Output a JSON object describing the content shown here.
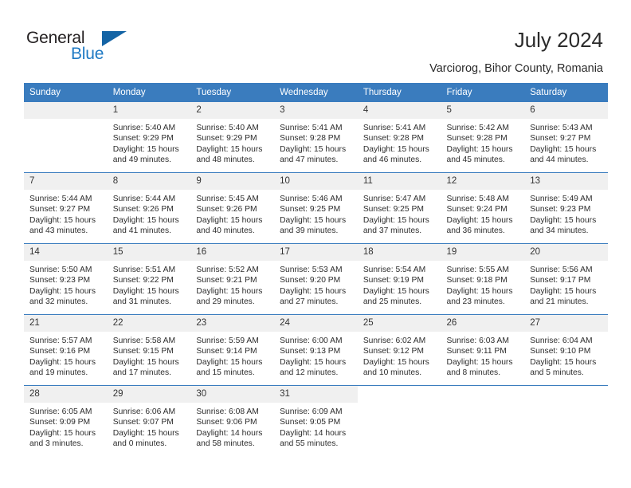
{
  "brand": {
    "line1": "General",
    "line2": "Blue",
    "logo_icon": "triangle-logo-icon",
    "colors": {
      "blue": "#1f7ac4",
      "dark_blue": "#1464a5",
      "text": "#231f20"
    }
  },
  "header": {
    "title": "July 2024",
    "subtitle": "Varciorog, Bihor County, Romania"
  },
  "calendar": {
    "accent_color": "#3a7cbe",
    "daynum_bg": "#f0f0f0",
    "weekday_headers": [
      "Sunday",
      "Monday",
      "Tuesday",
      "Wednesday",
      "Thursday",
      "Friday",
      "Saturday"
    ],
    "weeks": [
      [
        {
          "day": "",
          "lines": []
        },
        {
          "day": "1",
          "lines": [
            "Sunrise: 5:40 AM",
            "Sunset: 9:29 PM",
            "Daylight: 15 hours",
            "and 49 minutes."
          ]
        },
        {
          "day": "2",
          "lines": [
            "Sunrise: 5:40 AM",
            "Sunset: 9:29 PM",
            "Daylight: 15 hours",
            "and 48 minutes."
          ]
        },
        {
          "day": "3",
          "lines": [
            "Sunrise: 5:41 AM",
            "Sunset: 9:28 PM",
            "Daylight: 15 hours",
            "and 47 minutes."
          ]
        },
        {
          "day": "4",
          "lines": [
            "Sunrise: 5:41 AM",
            "Sunset: 9:28 PM",
            "Daylight: 15 hours",
            "and 46 minutes."
          ]
        },
        {
          "day": "5",
          "lines": [
            "Sunrise: 5:42 AM",
            "Sunset: 9:28 PM",
            "Daylight: 15 hours",
            "and 45 minutes."
          ]
        },
        {
          "day": "6",
          "lines": [
            "Sunrise: 5:43 AM",
            "Sunset: 9:27 PM",
            "Daylight: 15 hours",
            "and 44 minutes."
          ]
        }
      ],
      [
        {
          "day": "7",
          "lines": [
            "Sunrise: 5:44 AM",
            "Sunset: 9:27 PM",
            "Daylight: 15 hours",
            "and 43 minutes."
          ]
        },
        {
          "day": "8",
          "lines": [
            "Sunrise: 5:44 AM",
            "Sunset: 9:26 PM",
            "Daylight: 15 hours",
            "and 41 minutes."
          ]
        },
        {
          "day": "9",
          "lines": [
            "Sunrise: 5:45 AM",
            "Sunset: 9:26 PM",
            "Daylight: 15 hours",
            "and 40 minutes."
          ]
        },
        {
          "day": "10",
          "lines": [
            "Sunrise: 5:46 AM",
            "Sunset: 9:25 PM",
            "Daylight: 15 hours",
            "and 39 minutes."
          ]
        },
        {
          "day": "11",
          "lines": [
            "Sunrise: 5:47 AM",
            "Sunset: 9:25 PM",
            "Daylight: 15 hours",
            "and 37 minutes."
          ]
        },
        {
          "day": "12",
          "lines": [
            "Sunrise: 5:48 AM",
            "Sunset: 9:24 PM",
            "Daylight: 15 hours",
            "and 36 minutes."
          ]
        },
        {
          "day": "13",
          "lines": [
            "Sunrise: 5:49 AM",
            "Sunset: 9:23 PM",
            "Daylight: 15 hours",
            "and 34 minutes."
          ]
        }
      ],
      [
        {
          "day": "14",
          "lines": [
            "Sunrise: 5:50 AM",
            "Sunset: 9:23 PM",
            "Daylight: 15 hours",
            "and 32 minutes."
          ]
        },
        {
          "day": "15",
          "lines": [
            "Sunrise: 5:51 AM",
            "Sunset: 9:22 PM",
            "Daylight: 15 hours",
            "and 31 minutes."
          ]
        },
        {
          "day": "16",
          "lines": [
            "Sunrise: 5:52 AM",
            "Sunset: 9:21 PM",
            "Daylight: 15 hours",
            "and 29 minutes."
          ]
        },
        {
          "day": "17",
          "lines": [
            "Sunrise: 5:53 AM",
            "Sunset: 9:20 PM",
            "Daylight: 15 hours",
            "and 27 minutes."
          ]
        },
        {
          "day": "18",
          "lines": [
            "Sunrise: 5:54 AM",
            "Sunset: 9:19 PM",
            "Daylight: 15 hours",
            "and 25 minutes."
          ]
        },
        {
          "day": "19",
          "lines": [
            "Sunrise: 5:55 AM",
            "Sunset: 9:18 PM",
            "Daylight: 15 hours",
            "and 23 minutes."
          ]
        },
        {
          "day": "20",
          "lines": [
            "Sunrise: 5:56 AM",
            "Sunset: 9:17 PM",
            "Daylight: 15 hours",
            "and 21 minutes."
          ]
        }
      ],
      [
        {
          "day": "21",
          "lines": [
            "Sunrise: 5:57 AM",
            "Sunset: 9:16 PM",
            "Daylight: 15 hours",
            "and 19 minutes."
          ]
        },
        {
          "day": "22",
          "lines": [
            "Sunrise: 5:58 AM",
            "Sunset: 9:15 PM",
            "Daylight: 15 hours",
            "and 17 minutes."
          ]
        },
        {
          "day": "23",
          "lines": [
            "Sunrise: 5:59 AM",
            "Sunset: 9:14 PM",
            "Daylight: 15 hours",
            "and 15 minutes."
          ]
        },
        {
          "day": "24",
          "lines": [
            "Sunrise: 6:00 AM",
            "Sunset: 9:13 PM",
            "Daylight: 15 hours",
            "and 12 minutes."
          ]
        },
        {
          "day": "25",
          "lines": [
            "Sunrise: 6:02 AM",
            "Sunset: 9:12 PM",
            "Daylight: 15 hours",
            "and 10 minutes."
          ]
        },
        {
          "day": "26",
          "lines": [
            "Sunrise: 6:03 AM",
            "Sunset: 9:11 PM",
            "Daylight: 15 hours",
            "and 8 minutes."
          ]
        },
        {
          "day": "27",
          "lines": [
            "Sunrise: 6:04 AM",
            "Sunset: 9:10 PM",
            "Daylight: 15 hours",
            "and 5 minutes."
          ]
        }
      ],
      [
        {
          "day": "28",
          "lines": [
            "Sunrise: 6:05 AM",
            "Sunset: 9:09 PM",
            "Daylight: 15 hours",
            "and 3 minutes."
          ]
        },
        {
          "day": "29",
          "lines": [
            "Sunrise: 6:06 AM",
            "Sunset: 9:07 PM",
            "Daylight: 15 hours",
            "and 0 minutes."
          ]
        },
        {
          "day": "30",
          "lines": [
            "Sunrise: 6:08 AM",
            "Sunset: 9:06 PM",
            "Daylight: 14 hours",
            "and 58 minutes."
          ]
        },
        {
          "day": "31",
          "lines": [
            "Sunrise: 6:09 AM",
            "Sunset: 9:05 PM",
            "Daylight: 14 hours",
            "and 55 minutes."
          ]
        },
        {
          "day": "",
          "lines": []
        },
        {
          "day": "",
          "lines": []
        },
        {
          "day": "",
          "lines": []
        }
      ]
    ]
  }
}
